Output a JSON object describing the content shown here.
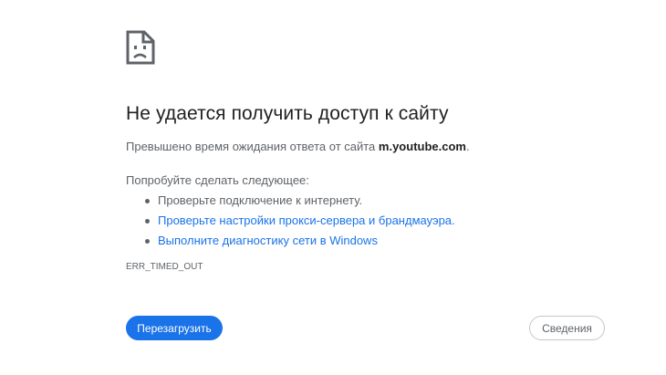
{
  "error": {
    "icon": "sad-document-icon",
    "title": "Не удается получить доступ к сайту",
    "description_prefix": "Превышено время ожидания ответа от сайта ",
    "description_host": "m.youtube.com",
    "description_suffix": ".",
    "suggestions_heading": "Попробуйте сделать следующее:",
    "suggestions": [
      {
        "text": "Проверьте подключение к интернету.",
        "is_link": false
      },
      {
        "text": "Проверьте настройки прокси-сервера и брандмауэра.",
        "is_link": true
      },
      {
        "text": "Выполните диагностику сети в Windows",
        "is_link": true
      }
    ],
    "code": "ERR_TIMED_OUT"
  },
  "buttons": {
    "reload_label": "Перезагрузить",
    "details_label": "Сведения"
  },
  "colors": {
    "accent": "#1a73e8",
    "text_primary": "#202124",
    "text_secondary": "#5f6368"
  }
}
